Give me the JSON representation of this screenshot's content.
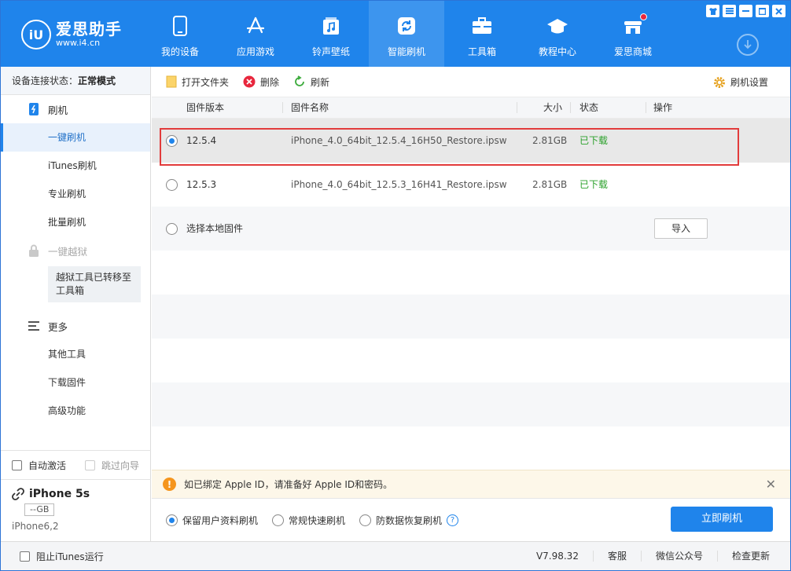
{
  "app": {
    "logo_badge": "iU",
    "logo_name": "爱思助手",
    "logo_url": "www.i4.cn",
    "brand_color": "#1f84eb"
  },
  "nav": [
    {
      "label": "我的设备",
      "icon": "phone-icon"
    },
    {
      "label": "应用游戏",
      "icon": "appstore-icon"
    },
    {
      "label": "铃声壁纸",
      "icon": "music-file-icon"
    },
    {
      "label": "智能刷机",
      "icon": "refresh-icon",
      "active": true
    },
    {
      "label": "工具箱",
      "icon": "toolbox-icon"
    },
    {
      "label": "教程中心",
      "icon": "graduation-cap-icon"
    },
    {
      "label": "爱思商城",
      "icon": "store-icon"
    }
  ],
  "sidebar": {
    "conn_label": "设备连接状态：",
    "conn_value": "正常模式",
    "flash_section": "刷机",
    "items": [
      "一键刷机",
      "iTunes刷机",
      "专业刷机",
      "批量刷机"
    ],
    "jailbreak": "一键越狱",
    "jailbreak_note": "越狱工具已转移至工具箱",
    "more_section": "更多",
    "more_items": [
      "其他工具",
      "下载固件",
      "高级功能"
    ],
    "auto_activate": "自动激活",
    "skip_guide": "跳过向导",
    "device_name": "iPhone 5s",
    "device_capacity": "--GB",
    "device_model": "iPhone6,2"
  },
  "toolbar": {
    "open_folder": "打开文件夹",
    "delete": "删除",
    "refresh": "刷新",
    "settings": "刷机设置"
  },
  "table": {
    "headers": {
      "version": "固件版本",
      "name": "固件名称",
      "size": "大小",
      "status": "状态",
      "action": "操作"
    },
    "rows": [
      {
        "version": "12.5.4",
        "name": "iPhone_4.0_64bit_12.5.4_16H50_Restore.ipsw",
        "size": "2.81GB",
        "status": "已下载",
        "selected": true
      },
      {
        "version": "12.5.3",
        "name": "iPhone_4.0_64bit_12.5.3_16H41_Restore.ipsw",
        "size": "2.81GB",
        "status": "已下载",
        "selected": false
      }
    ],
    "local_label": "选择本地固件",
    "import_label": "导入"
  },
  "notice": "如已绑定 Apple ID，请准备好 Apple ID和密码。",
  "options": [
    "保留用户资料刷机",
    "常规快速刷机",
    "防数据恢复刷机"
  ],
  "flash_button": "立即刷机",
  "footer": {
    "block_itunes": "阻止iTunes运行",
    "version": "V7.98.32",
    "support": "客服",
    "wechat": "微信公众号",
    "update": "检查更新"
  }
}
